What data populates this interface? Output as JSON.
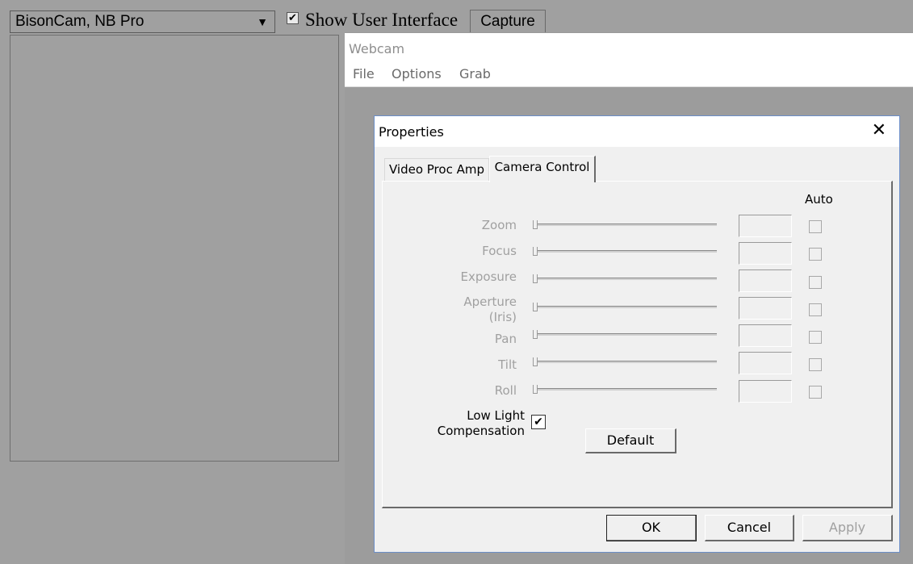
{
  "toolbar": {
    "camera_select": "BisonCam, NB Pro",
    "show_ui_checked": true,
    "show_ui_label": "Show User Interface",
    "capture_label": "Capture"
  },
  "webcam": {
    "title": "Webcam",
    "menu": [
      "File",
      "Options",
      "Grab"
    ]
  },
  "dialog": {
    "title": "Properties",
    "close_glyph": "✕",
    "tabs": [
      "Video Proc Amp",
      "Camera Control"
    ],
    "active_tab": "Camera Control",
    "auto_header": "Auto",
    "controls": [
      {
        "label": "Zoom"
      },
      {
        "label": "Focus"
      },
      {
        "label": "Exposure"
      },
      {
        "label": "Aperture\n(Iris)"
      },
      {
        "label": "Pan"
      },
      {
        "label": "Tilt"
      },
      {
        "label": "Roll"
      }
    ],
    "low_light_label": "Low Light\nCompensation",
    "low_light_checked": true,
    "default_label": "Default",
    "ok_label": "OK",
    "cancel_label": "Cancel",
    "apply_label": "Apply"
  }
}
